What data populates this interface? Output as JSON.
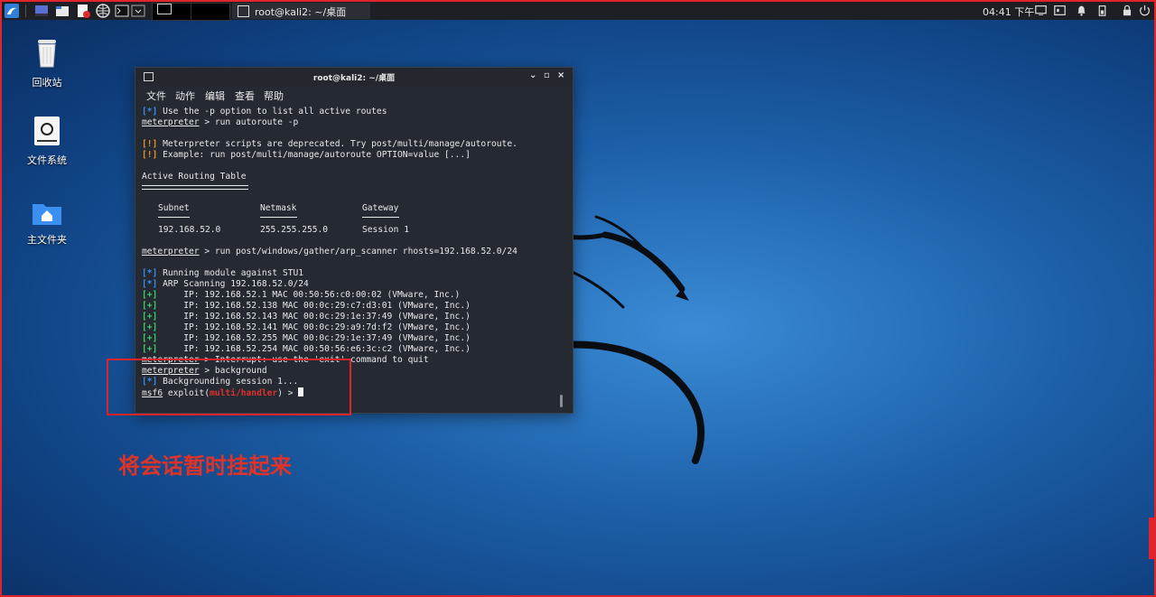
{
  "panel": {
    "icons": [
      "kali-menu-icon",
      "workspace-show-icon",
      "file-manager-icon",
      "text-editor-icon",
      "browser-icon",
      "terminal-icon",
      "chevron-down-icon"
    ],
    "task_title": "root@kali2: ~/桌面",
    "clock": "04:41 下午",
    "tray": [
      "display-icon",
      "volume-icon",
      "notification-bell-icon",
      "battery-icon",
      "lock-icon",
      "power-icon"
    ]
  },
  "desktop": {
    "icons": [
      {
        "label": "回收站",
        "icon": "trash-icon"
      },
      {
        "label": "文件系统",
        "icon": "filesystem-icon"
      },
      {
        "label": "主文件夹",
        "icon": "home-folder-icon"
      }
    ]
  },
  "terminal": {
    "title": "root@kali2: ~/桌面",
    "controls": {
      "minimize": "⌄",
      "maximize": "▫",
      "close": "×"
    },
    "menu": [
      "文件",
      "动作",
      "编辑",
      "查看",
      "帮助"
    ],
    "lines": {
      "l1_tag": "[*]",
      "l1_text": " Use the -p option to list all active routes",
      "prompt": "meterpreter",
      "l2_cmd": " > run autoroute -p",
      "l3_tag": "[!]",
      "l3_text": " Meterpreter scripts are deprecated. Try post/multi/manage/autoroute.",
      "l4_tag": "[!]",
      "l4_text": " Example: run post/multi/manage/autoroute OPTION=value [...]",
      "table_title": "Active Routing Table",
      "col_subnet": "Subnet",
      "col_netmask": "Netmask",
      "col_gateway": "Gateway",
      "row_subnet": "192.168.52.0",
      "row_netmask": "255.255.255.0",
      "row_gateway": "Session 1",
      "l5_cmd": " > run post/windows/gather/arp_scanner rhosts=192.168.52.0/24",
      "l6_tag": "[*]",
      "l6_text": " Running module against STU1",
      "l7_tag": "[*]",
      "l7_text": " ARP Scanning 192.168.52.0/24",
      "arp": [
        {
          "tag": "[+]",
          "text": "     IP: 192.168.52.1 MAC 00:50:56:c0:00:02 (VMware, Inc.)"
        },
        {
          "tag": "[+]",
          "text": "     IP: 192.168.52.138 MAC 00:0c:29:c7:d3:01 (VMware, Inc.)"
        },
        {
          "tag": "[+]",
          "text": "     IP: 192.168.52.143 MAC 00:0c:29:1e:37:49 (VMware, Inc.)"
        },
        {
          "tag": "[+]",
          "text": "     IP: 192.168.52.141 MAC 00:0c:29:a9:7d:f2 (VMware, Inc.)"
        },
        {
          "tag": "[+]",
          "text": "     IP: 192.168.52.255 MAC 00:0c:29:1e:37:49 (VMware, Inc.)"
        },
        {
          "tag": "[+]",
          "text": "     IP: 192.168.52.254 MAC 00:50:56:e6:3c:c2 (VMware, Inc.)"
        }
      ],
      "l8_text": " > Interrupt: use the 'exit' command to quit",
      "l9_cmd": " > background",
      "l10_tag": "[*]",
      "l10_text": " Backgrounding session 1...",
      "msf": "msf6",
      "exploit": " exploit(",
      "module": "multi/handler",
      "tail": ") > "
    }
  },
  "annotation": {
    "text": "将会话暂时挂起来",
    "color": "#e03328"
  },
  "colors": {
    "blue": "#3a8df0",
    "orange": "#e8922a",
    "green": "#3fcf6e",
    "red": "#e0312e",
    "terminal_bg": "#252931"
  }
}
